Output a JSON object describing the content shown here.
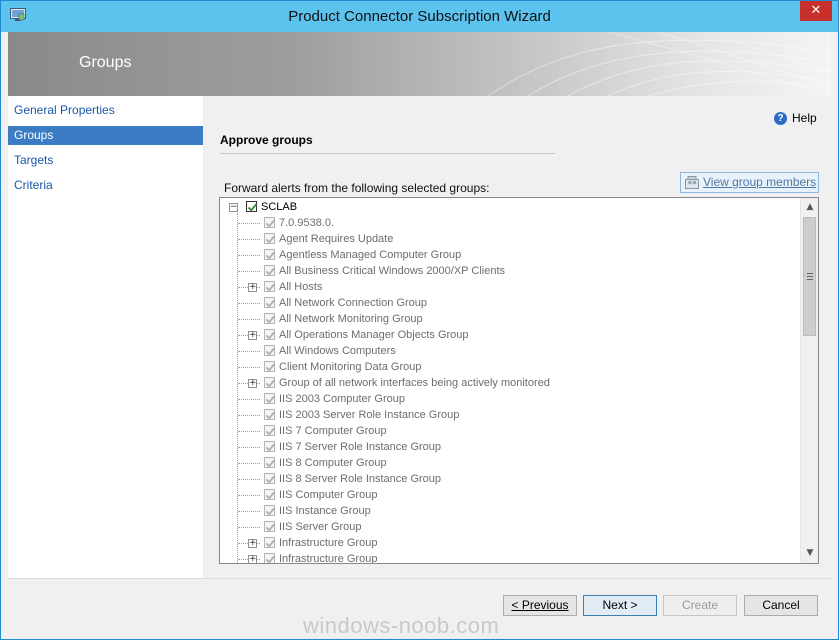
{
  "window": {
    "title": "Product Connector Subscription Wizard",
    "close_glyph": "✕",
    "icon": "wizard-app-icon"
  },
  "banner": {
    "title": "Groups"
  },
  "nav": {
    "items": [
      {
        "label": "General Properties",
        "selected": false
      },
      {
        "label": "Groups",
        "selected": true
      },
      {
        "label": "Targets",
        "selected": false
      },
      {
        "label": "Criteria",
        "selected": false
      }
    ]
  },
  "content": {
    "help_label": "Help",
    "help_glyph": "?",
    "section_title": "Approve groups",
    "forward_label": "Forward alerts from the following selected groups:",
    "view_members_label": "View group members"
  },
  "tree": {
    "root": {
      "label": "SCLAB",
      "expander": "−",
      "checked": true
    },
    "children": [
      {
        "label": "7.0.9538.0.",
        "expandable": false
      },
      {
        "label": "Agent Requires Update",
        "expandable": false
      },
      {
        "label": "Agentless Managed Computer Group",
        "expandable": false
      },
      {
        "label": "All Business Critical Windows 2000/XP Clients",
        "expandable": false
      },
      {
        "label": "All Hosts",
        "expandable": true
      },
      {
        "label": "All Network Connection Group",
        "expandable": false
      },
      {
        "label": "All Network Monitoring Group",
        "expandable": false
      },
      {
        "label": "All Operations Manager Objects Group",
        "expandable": true
      },
      {
        "label": "All Windows Computers",
        "expandable": false
      },
      {
        "label": "Client Monitoring Data Group",
        "expandable": false
      },
      {
        "label": "Group of all network interfaces being actively monitored",
        "expandable": true
      },
      {
        "label": "IIS 2003 Computer Group",
        "expandable": false
      },
      {
        "label": "IIS 2003 Server Role Instance Group",
        "expandable": false
      },
      {
        "label": "IIS 7 Computer Group",
        "expandable": false
      },
      {
        "label": "IIS 7 Server Role Instance Group",
        "expandable": false
      },
      {
        "label": "IIS 8 Computer Group",
        "expandable": false
      },
      {
        "label": "IIS 8 Server Role Instance Group",
        "expandable": false
      },
      {
        "label": "IIS Computer Group",
        "expandable": false
      },
      {
        "label": "IIS Instance Group",
        "expandable": false
      },
      {
        "label": "IIS Server Group",
        "expandable": false
      },
      {
        "label": "Infrastructure Group",
        "expandable": true
      },
      {
        "label": "Infrastructure Group",
        "expandable": true
      }
    ],
    "expander_plus": "+",
    "scroll_up": "▲",
    "scroll_down": "▼"
  },
  "buttons": {
    "previous": "< Previous",
    "next": "Next >",
    "create": "Create",
    "cancel": "Cancel"
  },
  "watermark": "windows-noob.com",
  "colors": {
    "titlebar": "#5cc2ee",
    "close": "#c7302b",
    "nav_selected": "#3b7cc4",
    "link": "#1b56a6",
    "check": "#2e8b2e"
  }
}
